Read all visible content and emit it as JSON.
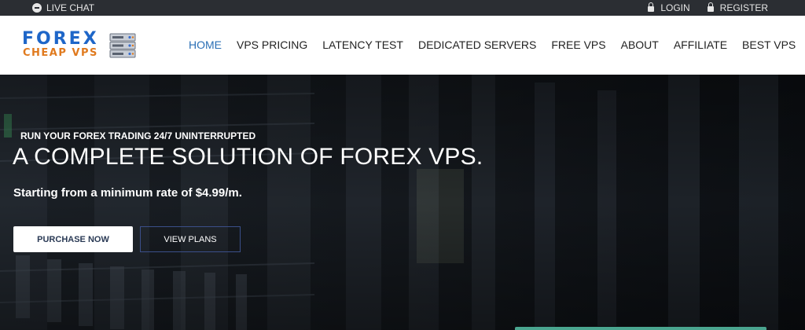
{
  "topbar": {
    "live_chat": "LIVE CHAT",
    "login": "LOGIN",
    "register": "REGISTER"
  },
  "logo": {
    "line1": "FOREX",
    "line2": "CHEAP VPS"
  },
  "nav": {
    "items": [
      {
        "label": "HOME",
        "active": true
      },
      {
        "label": "VPS PRICING"
      },
      {
        "label": "LATENCY TEST"
      },
      {
        "label": "DEDICATED SERVERS"
      },
      {
        "label": "FREE VPS"
      },
      {
        "label": "ABOUT"
      },
      {
        "label": "AFFILIATE"
      },
      {
        "label": "BEST VPS"
      }
    ]
  },
  "hero": {
    "eyebrow": "RUN YOUR FOREX TRADING 24/7 UNINTERRUPTED",
    "title": "A COMPLETE SOLUTION OF FOREX VPS.",
    "subtitle": "Starting from a minimum rate of $4.99/m.",
    "primary_button": "PURCHASE NOW",
    "secondary_button": "VIEW PLANS"
  },
  "colors": {
    "accent": "#2a6fb5",
    "logo_blue": "#1e66c8",
    "logo_orange": "#e07a1e",
    "topbar": "#2b2e33"
  }
}
